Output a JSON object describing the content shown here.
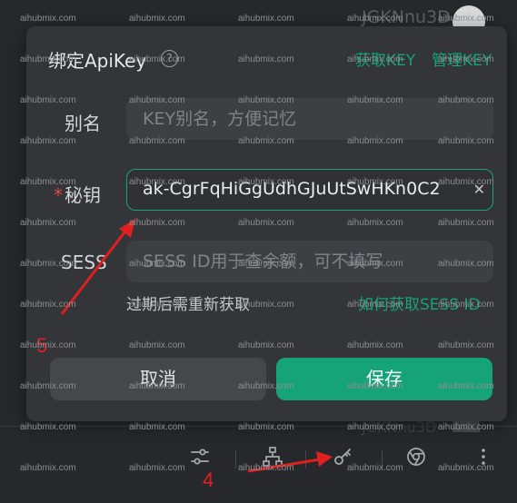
{
  "background": {
    "user_top": "JGKNnu3D",
    "user_bottom": "JGKNnu3D"
  },
  "dialog": {
    "title": "绑定ApiKey",
    "help_glyph": "?",
    "link_get_key": "获取KEY",
    "link_manage_key": "管理KEY",
    "alias": {
      "label": "别名",
      "placeholder": "KEY别名，方便记忆"
    },
    "secret": {
      "required_mark": "*",
      "label": "秘钥",
      "value": "ak-CgrFqHiGgUdhGJuUtSwHKn0C2",
      "clear_glyph": "✕"
    },
    "sess": {
      "label": "SESS",
      "placeholder": "SESS ID用于查余额，可不填写"
    },
    "hint": "过期后需重新获取",
    "hint_link": "如何获取SESS ID",
    "cancel": "取消",
    "save": "保存"
  },
  "toolbar": {
    "icons": [
      "sliders-icon",
      "network-icon",
      "key-icon",
      "chrome-icon",
      "more-vertical-icon"
    ]
  },
  "annotations": {
    "step_4": "4",
    "step_5": "5",
    "color": "#e02020"
  },
  "watermark": {
    "text": "aihubmix.com"
  },
  "colors": {
    "accent": "#17a378",
    "dialog_bg": "#333538",
    "page_bg": "#26282b"
  }
}
